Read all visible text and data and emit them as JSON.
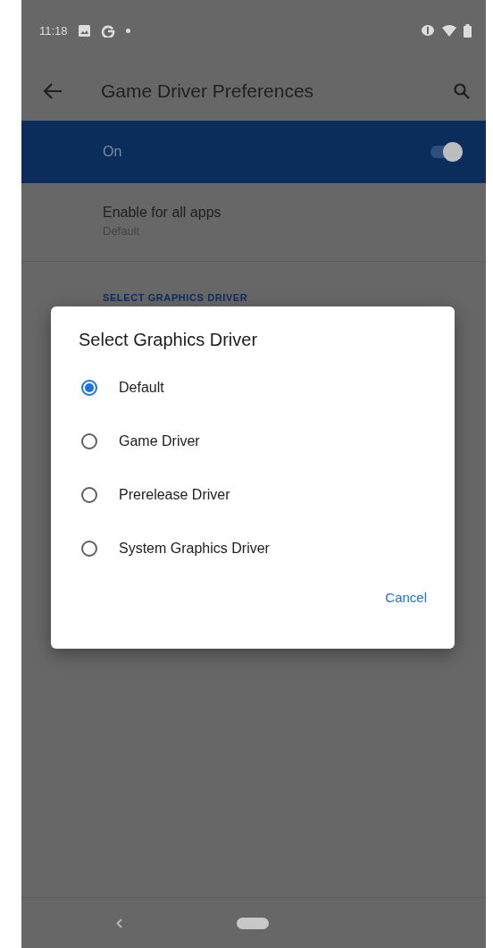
{
  "status_bar": {
    "time": "11:18"
  },
  "toolbar": {
    "title": "Game Driver Preferences"
  },
  "main_switch": {
    "label": "On",
    "on": true
  },
  "preferences": [
    {
      "title": "Enable for all apps",
      "summary": "Default"
    }
  ],
  "section_header": "SELECT GRAPHICS DRIVER",
  "dialog": {
    "title": "Select Graphics Driver",
    "options": [
      {
        "label": "Default",
        "selected": true
      },
      {
        "label": "Game Driver",
        "selected": false
      },
      {
        "label": "Prerelease Driver",
        "selected": false
      },
      {
        "label": "System Graphics Driver",
        "selected": false
      }
    ],
    "buttons": [
      "Cancel"
    ]
  }
}
